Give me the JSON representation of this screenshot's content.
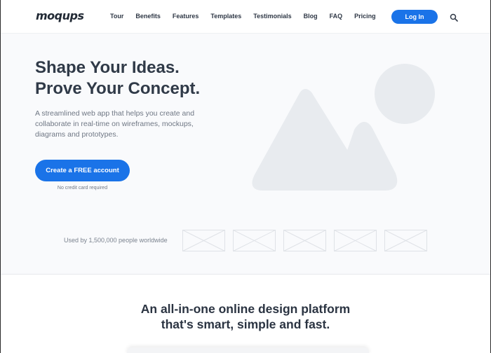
{
  "brand": {
    "logo_text": "moqups"
  },
  "nav": {
    "items": [
      {
        "label": "Tour"
      },
      {
        "label": "Benefits"
      },
      {
        "label": "Features"
      },
      {
        "label": "Templates"
      },
      {
        "label": "Testimonials"
      },
      {
        "label": "Blog"
      },
      {
        "label": "FAQ"
      },
      {
        "label": "Pricing"
      }
    ],
    "login_label": "Log In",
    "search_icon": "search-icon"
  },
  "hero": {
    "title_line1": "Shape Your Ideas.",
    "title_line2": "Prove Your Concept.",
    "subtitle": "A streamlined web app that helps you create and collaborate in real-time on wireframes, mockups, diagrams and prototypes.",
    "cta_label": "Create a FREE account",
    "cta_note": "No credit card required",
    "illustration_icon": "mountain-sun-image-placeholder-icon"
  },
  "social_proof": {
    "text": "Used by 1,500,000 people worldwide",
    "logo_placeholder_count": 5
  },
  "section": {
    "title_line1": "An all-in-one online design platform",
    "title_line2": "that's smart, simple and fast."
  },
  "colors": {
    "accent": "#1a73e8",
    "text_dark": "#303a48",
    "text_muted": "#6f7784",
    "placeholder": "#e8ebef",
    "hero_bg": "#f9fafc"
  }
}
